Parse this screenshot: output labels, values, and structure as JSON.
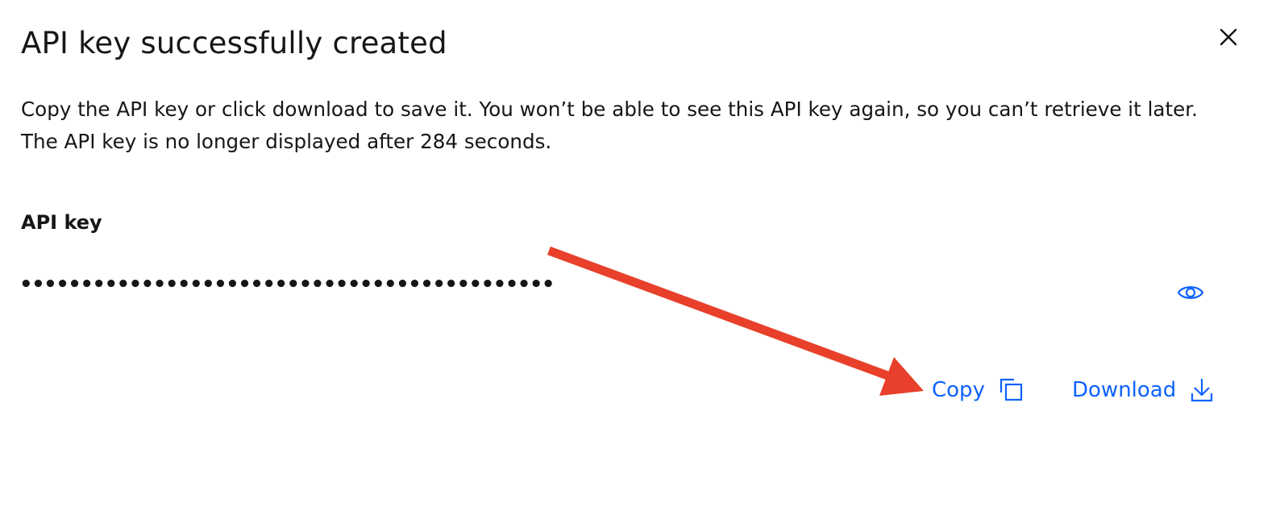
{
  "dialog": {
    "title": "API key successfully created",
    "close_icon": "close-icon",
    "description_line_1": "Copy the API key or click download to save it. You won’t be able to see this API key again, so you can’t retrieve it later.",
    "description_line_2": "The API key is no longer displayed after 284 seconds."
  },
  "api_key_field": {
    "label": "API key",
    "masked_value": "••••••••••••••••••••••••••••••••••••••••••••",
    "reveal_icon": "eye-icon"
  },
  "actions": {
    "copy_label": "Copy",
    "copy_icon": "copy-icon",
    "download_label": "Download",
    "download_icon": "download-icon"
  },
  "colors": {
    "text": "#161616",
    "link": "#0f62fe",
    "annotation_arrow": "#e8402a",
    "background": "#ffffff"
  }
}
